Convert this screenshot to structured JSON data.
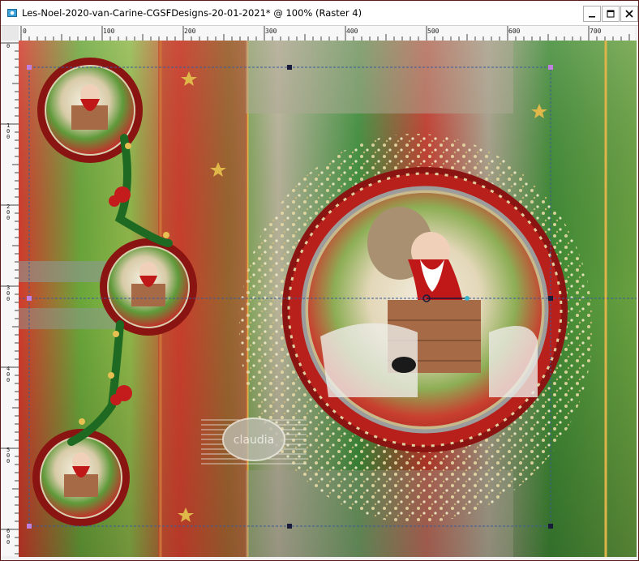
{
  "window": {
    "title": "Les-Noel-2020-van-Carine-CGSFDesigns-20-01-2021* @ 100% (Raster 4)",
    "app_icon": "psp-document-icon",
    "controls": {
      "minimize": "minimize-icon",
      "maximize": "maximize-icon",
      "close": "close-icon"
    }
  },
  "ruler": {
    "horizontal_labels": [
      "0",
      "100",
      "200",
      "300",
      "400",
      "500",
      "600",
      "700"
    ],
    "vertical_labels": [
      "0",
      "100",
      "200",
      "300",
      "400",
      "500",
      "600"
    ]
  },
  "canvas": {
    "layer": "Raster 4",
    "zoom": "100%",
    "watermark": {
      "text": "claudia",
      "subtext": ""
    },
    "colors": {
      "background_frame": "#5a0f0f",
      "red": "#c8302a",
      "green": "#4f8f2a",
      "gold": "#d8b040",
      "selection": "#3a5a9a"
    },
    "icons": [
      "santa-ornament-small-top",
      "santa-ornament-small-middle",
      "santa-ornament-small-bottom",
      "santa-ornament-large",
      "holly-garland",
      "gold-star",
      "selection-handle"
    ]
  }
}
